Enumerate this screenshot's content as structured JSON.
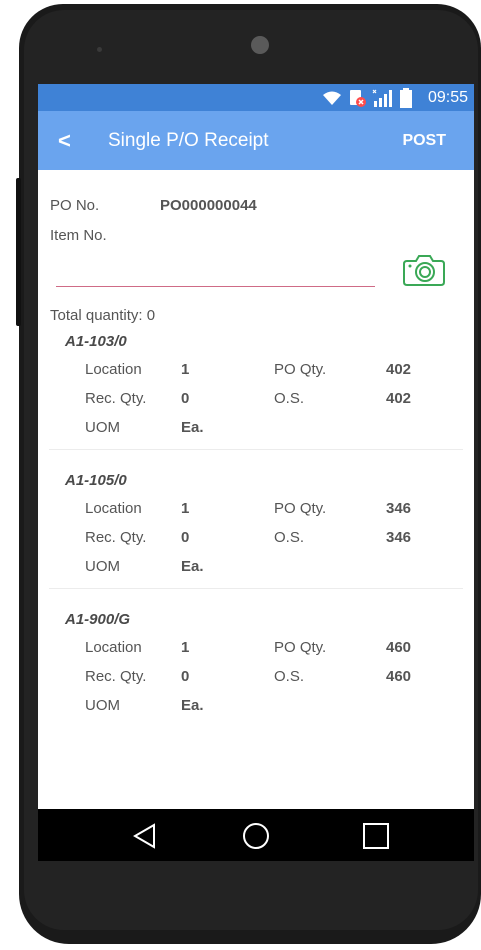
{
  "status_bar": {
    "time": "09:55",
    "icons": [
      "wifi-icon",
      "sim-blocked-icon",
      "signal-icon",
      "battery-icon"
    ]
  },
  "app_bar": {
    "back_label": "<",
    "title": "Single P/O Receipt",
    "post_label": "POST"
  },
  "form": {
    "po_label": "PO No.",
    "po_value": "PO000000044",
    "item_label": "Item No.",
    "item_value": "",
    "camera_icon": "camera-icon",
    "total_label": "Total quantity: 0"
  },
  "labels": {
    "location": "Location",
    "rec_qty": "Rec. Qty.",
    "uom": "UOM",
    "po_qty": "PO Qty.",
    "os": "O.S."
  },
  "items": [
    {
      "code": "A1-103/0",
      "location": "1",
      "rec_qty": "0",
      "uom": "Ea.",
      "po_qty": "402",
      "os": "402"
    },
    {
      "code": "A1-105/0",
      "location": "1",
      "rec_qty": "0",
      "uom": "Ea.",
      "po_qty": "346",
      "os": "346"
    },
    {
      "code": "A1-900/G",
      "location": "1",
      "rec_qty": "0",
      "uom": "Ea.",
      "po_qty": "460",
      "os": "460"
    }
  ],
  "nav_bar": {
    "icons": [
      "back-triangle-icon",
      "home-circle-icon",
      "recents-square-icon"
    ]
  },
  "colors": {
    "status_bar": "#3f82d6",
    "app_bar": "#6aa4ee",
    "input_underline": "#cf6b86",
    "camera_icon": "#3aa856"
  }
}
